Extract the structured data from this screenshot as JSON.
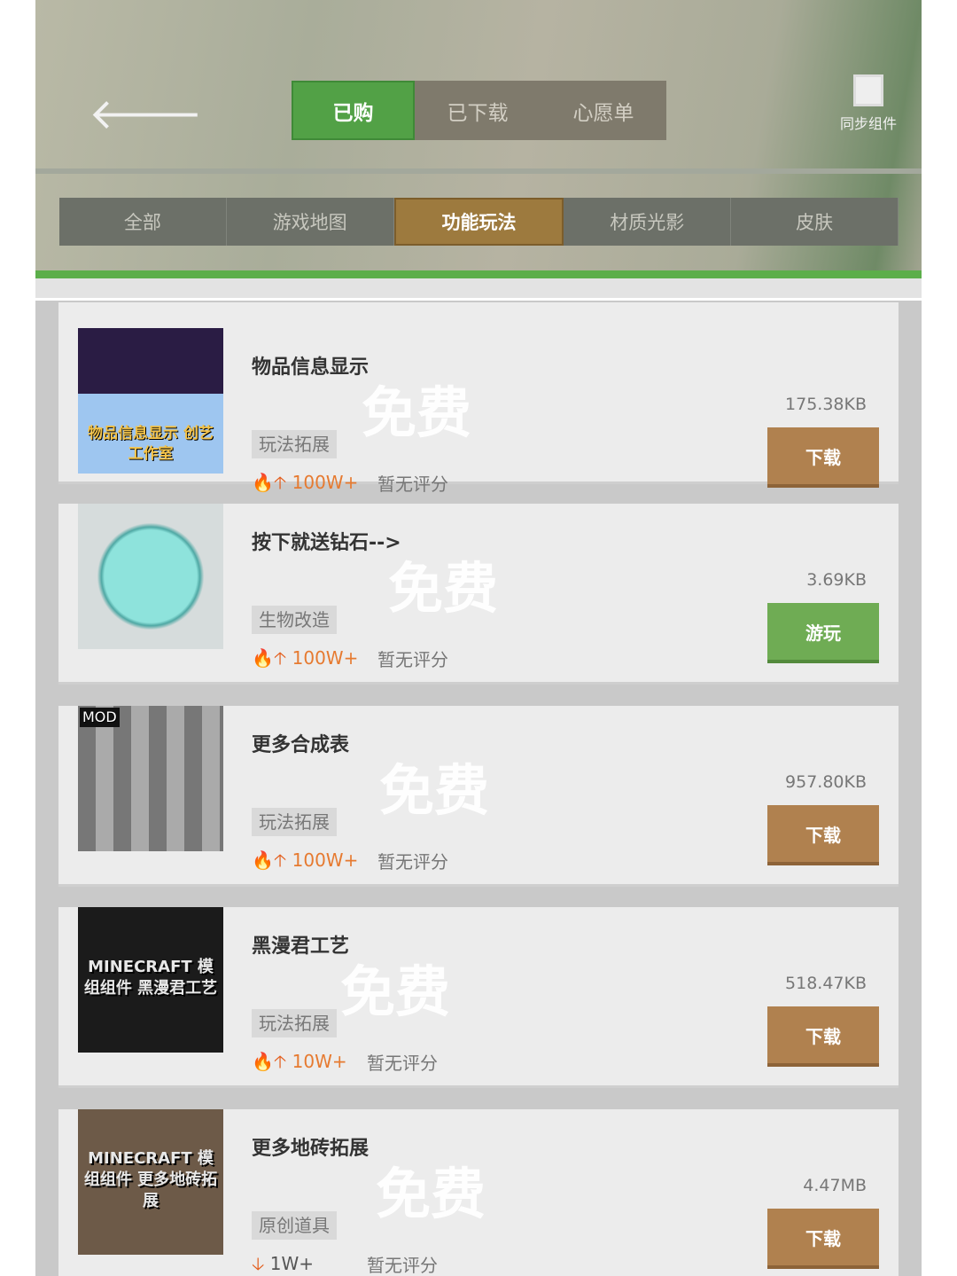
{
  "header": {
    "back_icon": "arrow-left-icon",
    "tabs": [
      {
        "label": "已购",
        "active": true
      },
      {
        "label": "已下载"
      },
      {
        "label": "心愿单"
      }
    ],
    "sync": {
      "label": "同步组件",
      "icon": "sync-monitor-icon"
    }
  },
  "categories": [
    {
      "label": "全部"
    },
    {
      "label": "游戏地图"
    },
    {
      "label": "功能玩法",
      "active": true
    },
    {
      "label": "材质光影"
    },
    {
      "label": "皮肤"
    }
  ],
  "colors": {
    "active_tab": "#52a146",
    "active_category": "#9d7a3e",
    "download_button": "#b0814f",
    "play_button": "#6fac54",
    "accent_line": "#5cae4a"
  },
  "watermark": "免费",
  "items": [
    {
      "title": "物品信息显示",
      "tag": "玩法拓展",
      "downloads": "100W+",
      "rating": "暂无评分",
      "size": "175.38KB",
      "button": "下载",
      "thumb_text": "物品信息显示 创艺工作室"
    },
    {
      "title": "按下就送钻石-->",
      "tag": "生物改造",
      "downloads": "100W+",
      "rating": "暂无评分",
      "size": "3.69KB",
      "button": "游玩",
      "thumb_text": ""
    },
    {
      "title": "更多合成表",
      "tag": "玩法拓展",
      "downloads": "100W+",
      "rating": "暂无评分",
      "size": "957.80KB",
      "button": "下载",
      "thumb_text": "MOD"
    },
    {
      "title": "黑漫君工艺",
      "tag": "玩法拓展",
      "downloads": "10W+",
      "rating": "暂无评分",
      "size": "518.47KB",
      "button": "下载",
      "thumb_text": "MINECRAFT 模组组件 黑漫君工艺"
    },
    {
      "title": "更多地砖拓展",
      "tag": "原创道具",
      "downloads": "1W+",
      "rating": "暂无评分",
      "size": "4.47MB",
      "button": "下载",
      "thumb_text": "MINECRAFT 模组组件 更多地砖拓展"
    }
  ]
}
